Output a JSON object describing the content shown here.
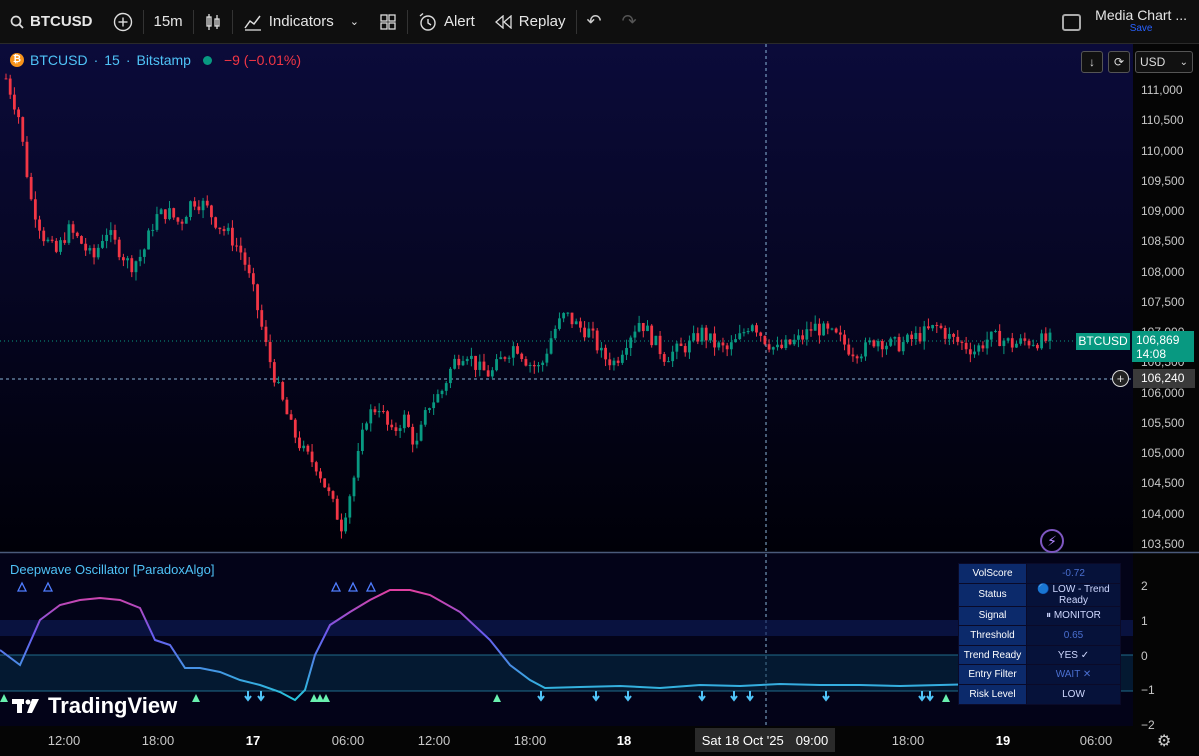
{
  "toolbar": {
    "symbol": "BTCUSD",
    "interval": "15m",
    "indicators": "Indicators",
    "alert": "Alert",
    "replay": "Replay",
    "layout_title": "Media Chart ...",
    "layout_save": "Save"
  },
  "legend": {
    "symbol": "BTCUSD",
    "interval": "15",
    "exchange": "Bitstamp",
    "change": "−9 (−0.01%)",
    "separator": "·",
    "coin_icon": "₿"
  },
  "controls": {
    "currency": "USD"
  },
  "price_axis": {
    "labels": [
      "111,000",
      "110,500",
      "110,000",
      "109,500",
      "109,000",
      "108,500",
      "108,000",
      "107,500",
      "107,000",
      "106,500",
      "106,000",
      "105,500",
      "105,000",
      "104,500",
      "104,000",
      "103,500"
    ],
    "last_price": "106,869",
    "countdown": "14:08",
    "symbol_tag": "BTCUSD",
    "crosshair_price": "106,240"
  },
  "indicator": {
    "title": "Deepwave Oscillator [ParadoxAlgo]",
    "axis": [
      "2",
      "1",
      "0",
      "−1",
      "−2"
    ],
    "table": [
      {
        "key": "VolScore",
        "value": "-0.72",
        "dim": true
      },
      {
        "key": "Status",
        "value": "🔵 LOW - Trend Ready",
        "dim": false
      },
      {
        "key": "Signal",
        "value": "⏸ MONITOR",
        "dim": false
      },
      {
        "key": "Threshold",
        "value": "0.65",
        "dim": true
      },
      {
        "key": "Trend Ready",
        "value": "YES ✓",
        "dim": false
      },
      {
        "key": "Entry Filter",
        "value": "WAIT ✕",
        "dim": true
      },
      {
        "key": "Risk Level",
        "value": "LOW",
        "dim": false
      }
    ]
  },
  "time_axis": {
    "labels": [
      {
        "text": "12:00",
        "bold": false
      },
      {
        "text": "18:00",
        "bold": false
      },
      {
        "text": "17",
        "bold": true
      },
      {
        "text": "06:00",
        "bold": false
      },
      {
        "text": "12:00",
        "bold": false
      },
      {
        "text": "18:00",
        "bold": false
      },
      {
        "text": "18",
        "bold": true
      },
      {
        "text": "18:00",
        "bold": false
      },
      {
        "text": "19",
        "bold": true
      },
      {
        "text": "06:00",
        "bold": false
      }
    ],
    "crosshair_date": "Sat 18 Oct '25",
    "crosshair_time": "09:00"
  },
  "branding": {
    "logo": "TradingView"
  },
  "colors": {
    "up": "#089981",
    "down": "#f23645",
    "accent": "#4fc3f7"
  },
  "chart_data": {
    "type": "line",
    "series": [
      {
        "values": [
          111200,
          110600,
          109200,
          108600,
          108300,
          108700,
          108500,
          108200,
          108700,
          108400,
          108100,
          108300,
          108900,
          109000,
          108800,
          109200,
          109100,
          108800,
          108600,
          108300,
          107600,
          106700,
          106000,
          105400,
          105000,
          104800,
          104300,
          103800,
          104600,
          105600,
          105800,
          105300,
          105600,
          105100,
          105800,
          106000,
          106500,
          106700,
          106400,
          106300,
          106600,
          106800,
          106500,
          106400,
          107000,
          107300,
          107100,
          107000,
          106600,
          106500,
          106900,
          107200,
          106900,
          106600,
          106700,
          106800,
          107000,
          106800,
          106700,
          106900,
          107200,
          106900,
          106700,
          106800,
          106900,
          107100,
          107000,
          106900,
          106700,
          106700,
          106900,
          106800,
          106800,
          106900,
          107000,
          107100,
          106900,
          106800,
          106700,
          106900,
          106900,
          106800,
          106850,
          106860,
          106869
        ]
      }
    ]
  }
}
